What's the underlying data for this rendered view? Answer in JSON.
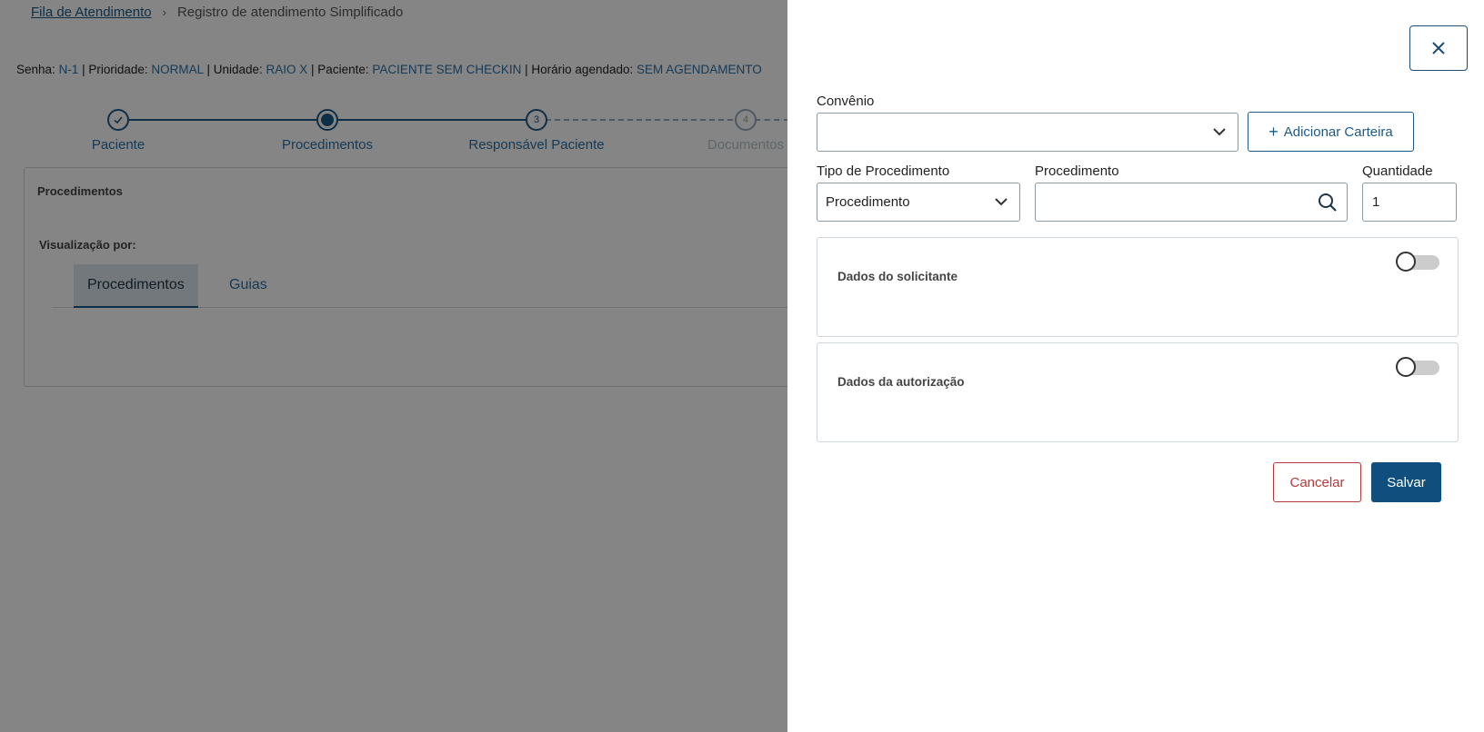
{
  "breadcrumb": {
    "root": "Fila de Atendimento",
    "current": "Registro de atendimento Simplificado"
  },
  "infobar": {
    "senha_label": "Senha:",
    "senha": "N-1",
    "prioridade_label": "| Prioridade:",
    "prioridade": "NORMAL",
    "unidade_label": "| Unidade:",
    "unidade": "RAIO X",
    "paciente_label": "| Paciente:",
    "paciente": "PACIENTE SEM CHECKIN",
    "horario_label": "| Horário agendado:",
    "horario": "SEM AGENDAMENTO"
  },
  "stepper": {
    "steps": [
      {
        "label": "Paciente",
        "number": ""
      },
      {
        "label": "Procedimentos",
        "number": ""
      },
      {
        "label": "Responsável Paciente",
        "number": "3"
      },
      {
        "label": "Documentos",
        "number": "4"
      }
    ]
  },
  "card": {
    "title": "Procedimentos",
    "view_label": "Visualização por:",
    "tabs": [
      {
        "label": "Procedimentos"
      },
      {
        "label": "Guias"
      }
    ]
  },
  "drawer": {
    "convenio_label": "Convênio",
    "convenio_value": "",
    "add_wallet_label": "Adicionar Carteira",
    "tipo_label": "Tipo de Procedimento",
    "tipo_value": "Procedimento",
    "procedimento_label": "Procedimento",
    "procedimento_value": "",
    "quantidade_label": "Quantidade",
    "quantidade_value": "1",
    "sections": [
      {
        "title": "Dados do solicitante",
        "enabled": false
      },
      {
        "title": "Dados da autorização",
        "enabled": false
      }
    ],
    "cancel_label": "Cancelar",
    "save_label": "Salvar"
  },
  "colors": {
    "primary": "#0f4e7d",
    "link": "#2c6fa3",
    "danger": "#b23a3a"
  }
}
